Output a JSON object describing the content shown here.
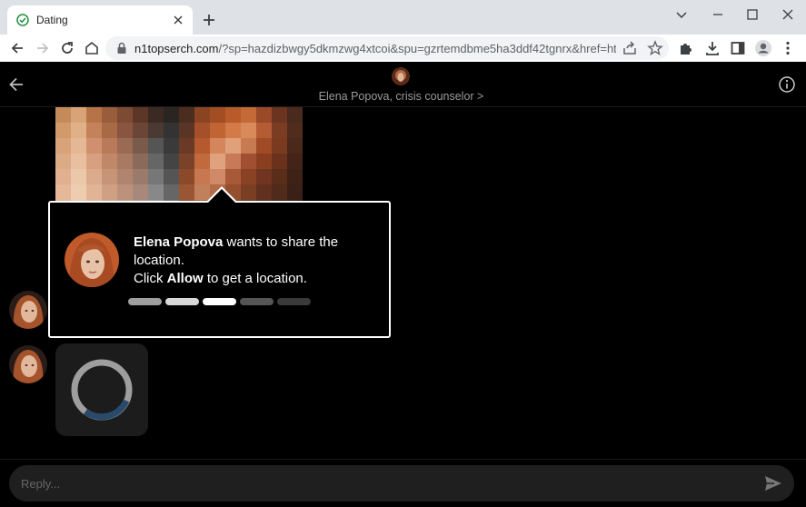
{
  "browser": {
    "tab_title": "Dating",
    "url_domain": "n1topserch.com",
    "url_rest": "/?sp=hazdizbwgy5dkmzwg4xtcoi&spu=gzrtemdbme5ha3ddf42tgnrx&href=https:/..."
  },
  "icons": {
    "favicon": "check-circle-icon",
    "back": "arrow-left-icon",
    "forward": "arrow-right-icon",
    "reload": "reload-icon",
    "home": "home-icon",
    "lock": "lock-icon",
    "share": "share-icon",
    "bookmark": "star-icon",
    "extensions": "puzzle-icon",
    "download": "download-icon",
    "sidepanel": "sidepanel-icon",
    "profile": "profile-icon",
    "menu": "kebab-menu-icon",
    "info": "info-icon",
    "send": "send-icon"
  },
  "chat": {
    "header_name": "Elena Popova, crisis counselor >",
    "popup": {
      "name": "Elena Popova",
      "line1_rest": " wants to share the location.",
      "line2_prefix": "Click ",
      "line2_bold": "Allow",
      "line2_suffix": " to get a location.",
      "progress_total": 5,
      "progress_active": 3
    },
    "reply_placeholder": "Reply..."
  },
  "colors": {
    "accent_green": "#1e8e3e",
    "loader_gray": "#9e9e9e",
    "loader_blue": "#2a4a6b"
  }
}
